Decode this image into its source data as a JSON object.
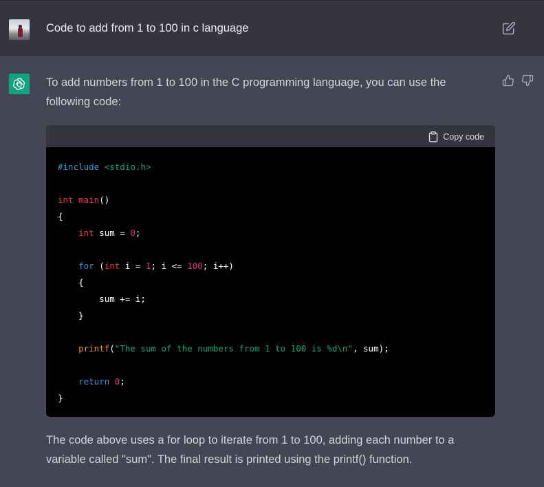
{
  "user_message": {
    "text": "Code to add from 1 to 100 in c language"
  },
  "assistant_message": {
    "intro": "To add numbers from 1 to 100 in the C programming language, you can use the following code:",
    "copy_label": "Copy code",
    "code_lines": [
      [
        {
          "t": "#include ",
          "c": "kw"
        },
        {
          "t": "<stdio.h>",
          "c": "str"
        }
      ],
      [],
      [
        {
          "t": "int ",
          "c": "type"
        },
        {
          "t": "main",
          "c": "fn"
        },
        {
          "t": "()",
          "c": ""
        }
      ],
      [
        {
          "t": "{",
          "c": ""
        }
      ],
      [
        {
          "t": "    ",
          "c": ""
        },
        {
          "t": "int",
          "c": "type"
        },
        {
          "t": " sum = ",
          "c": ""
        },
        {
          "t": "0",
          "c": "num"
        },
        {
          "t": ";",
          "c": ""
        }
      ],
      [],
      [
        {
          "t": "    ",
          "c": ""
        },
        {
          "t": "for",
          "c": "kw"
        },
        {
          "t": " (",
          "c": ""
        },
        {
          "t": "int",
          "c": "type"
        },
        {
          "t": " i = ",
          "c": ""
        },
        {
          "t": "1",
          "c": "num"
        },
        {
          "t": "; i <= ",
          "c": ""
        },
        {
          "t": "100",
          "c": "num"
        },
        {
          "t": "; i++)",
          "c": ""
        }
      ],
      [
        {
          "t": "    {",
          "c": ""
        }
      ],
      [
        {
          "t": "        sum += i;",
          "c": ""
        }
      ],
      [
        {
          "t": "    }",
          "c": ""
        }
      ],
      [],
      [
        {
          "t": "    ",
          "c": ""
        },
        {
          "t": "printf",
          "c": "call"
        },
        {
          "t": "(",
          "c": ""
        },
        {
          "t": "\"The sum of the numbers from 1 to 100 is %d\\n\"",
          "c": "str"
        },
        {
          "t": ", sum);",
          "c": ""
        }
      ],
      [],
      [
        {
          "t": "    ",
          "c": ""
        },
        {
          "t": "return",
          "c": "kw"
        },
        {
          "t": " ",
          "c": ""
        },
        {
          "t": "0",
          "c": "num"
        },
        {
          "t": ";",
          "c": ""
        }
      ],
      [
        {
          "t": "}",
          "c": ""
        }
      ]
    ],
    "outro": "The code above uses a for loop to iterate from 1 to 100, adding each number to a variable called \"sum\". The final result is printed using the printf() function."
  },
  "icons": {
    "edit": "edit-icon",
    "thumbs_up": "thumbs-up-icon",
    "thumbs_down": "thumbs-down-icon",
    "clipboard": "clipboard-icon",
    "assistant_logo": "openai-logo-icon"
  },
  "colors": {
    "user_bg": "#343541",
    "assistant_bg": "#444654",
    "code_bg": "#000000",
    "code_header_bg": "#343541",
    "assistant_avatar": "#10a37f"
  }
}
